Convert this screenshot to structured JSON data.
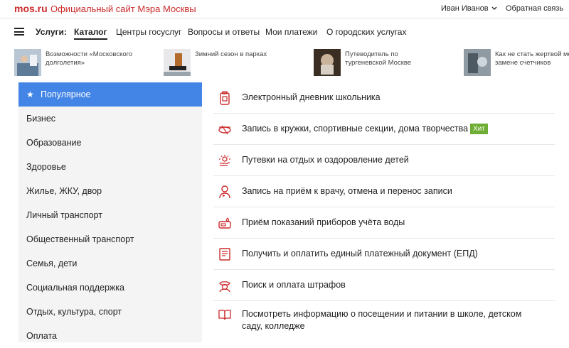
{
  "top": {
    "logo": "mos.ru",
    "site_title": "Официальный сайт Мэра Москвы",
    "user": "Иван Иванов",
    "feedback": "Обратная связь"
  },
  "nav": {
    "label": "Услуги:",
    "items": [
      "Каталог",
      "Центры госуслуг",
      "Вопросы и ответы",
      "Мои платежи",
      "О городских услугах"
    ]
  },
  "news": [
    {
      "text": "Возможности «Московского долголетия»"
    },
    {
      "text": "Зимний сезон в парках"
    },
    {
      "text": "Путеводитель по тургеневской Москве"
    },
    {
      "text": "Как не стать жертвой мо при замене счетчиков"
    }
  ],
  "sidebar": {
    "items": [
      "Популярное",
      "Бизнес",
      "Образование",
      "Здоровье",
      "Жилье, ЖКУ, двор",
      "Личный транспорт",
      "Общественный транспорт",
      "Семья, дети",
      "Социальная поддержка",
      "Отдых, культура, спорт",
      "Оплата"
    ]
  },
  "services": [
    {
      "text": "Электронный дневник школьника",
      "icon": "diary-icon"
    },
    {
      "text": "Запись в кружки, спортивные секции, дома творчества",
      "icon": "ball-icon",
      "badge": "Хит"
    },
    {
      "text": "Путевки на отдых и оздоровление детей",
      "icon": "sun-icon"
    },
    {
      "text": "Запись на приём к врачу, отмена и перенос записи",
      "icon": "doctor-icon"
    },
    {
      "text": "Приём показаний приборов учёта воды",
      "icon": "water-meter-icon"
    },
    {
      "text": "Получить и оплатить единый платежный документ (ЕПД)",
      "icon": "document-icon"
    },
    {
      "text": "Поиск и оплата штрафов",
      "icon": "police-icon"
    },
    {
      "text": "Посмотреть информацию о посещении и питании в школе, детском саду, колледже",
      "icon": "book-icon"
    }
  ],
  "colors": {
    "brand": "#cc2a2a",
    "active": "#4285e6",
    "badge": "#6fae34"
  }
}
